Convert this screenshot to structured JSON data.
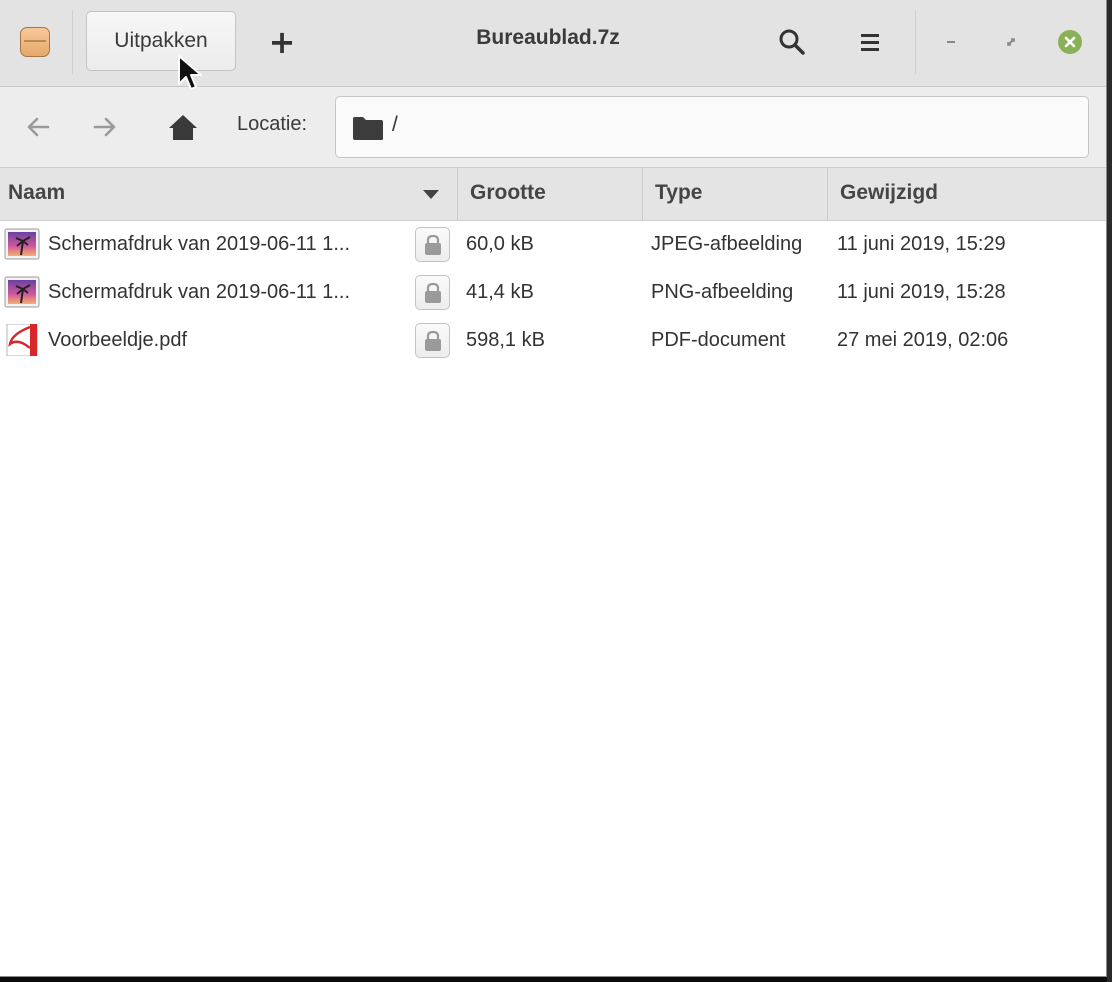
{
  "window": {
    "title": "Bureaublad.7z"
  },
  "toolbar": {
    "extract_label": "Uitpakken",
    "add_label": "+"
  },
  "location": {
    "label": "Locatie:",
    "path": "/"
  },
  "columns": {
    "name": "Naam",
    "size": "Grootte",
    "type": "Type",
    "modified": "Gewijzigd"
  },
  "files": [
    {
      "name": "Schermafdruk van 2019-06-11 1...",
      "size": "60,0 kB",
      "type": "JPEG-afbeelding",
      "modified": "11 juni 2019, 15:29",
      "icon": "image-icon",
      "locked": true
    },
    {
      "name": "Schermafdruk van 2019-06-11 1...",
      "size": "41,4 kB",
      "type": "PNG-afbeelding",
      "modified": "11 juni 2019, 15:28",
      "icon": "image-icon",
      "locked": true
    },
    {
      "name": "Voorbeeldje.pdf",
      "size": "598,1 kB",
      "type": "PDF-document",
      "modified": "27 mei 2019, 02:06",
      "icon": "pdf-icon",
      "locked": true
    }
  ],
  "colors": {
    "headerbar_bg": "#e3e3e3",
    "close_button": "#8bb158",
    "pdf_red": "#d8262b"
  }
}
